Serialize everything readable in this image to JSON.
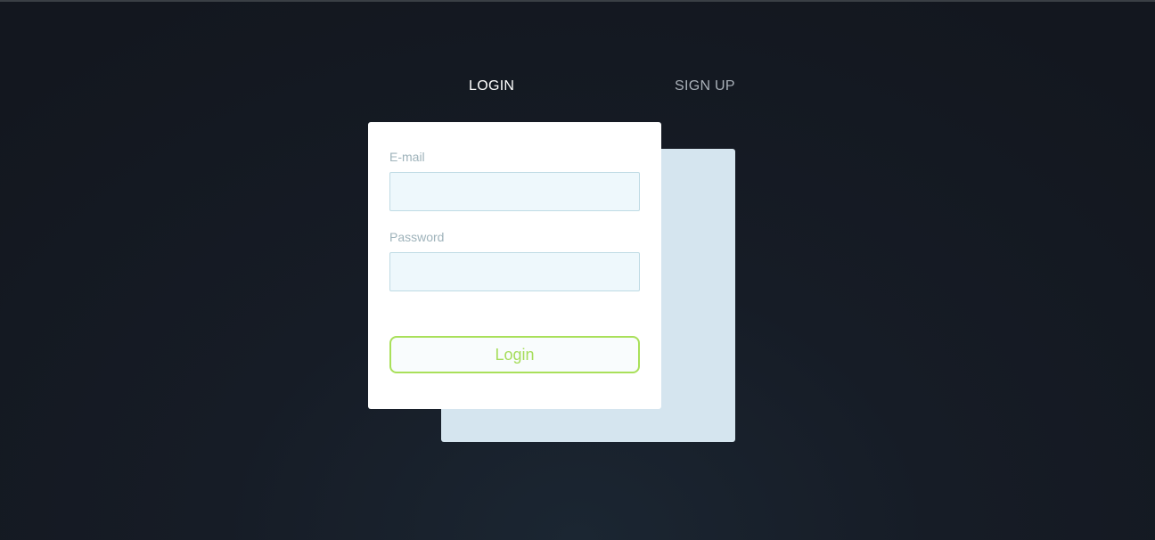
{
  "tabs": {
    "login_label": "LOGIN",
    "signup_label": "SIGN UP"
  },
  "login_form": {
    "email_label": "E-mail",
    "email_value": "",
    "password_label": "Password",
    "password_value": "",
    "submit_label": "Login"
  },
  "colors": {
    "background": "#161c26",
    "card": "#ffffff",
    "back_card": "#d5e5ef",
    "input_fill": "#eef8fc",
    "accent": "#a9e05a",
    "label_text": "#9fb3bb"
  }
}
